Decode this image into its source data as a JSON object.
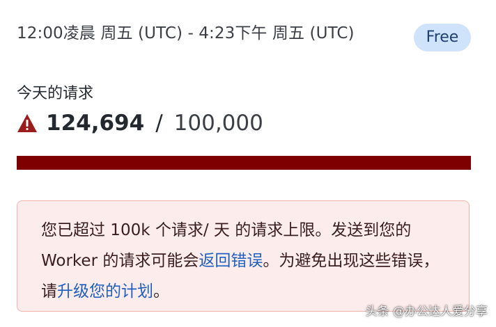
{
  "header": {
    "time_range": "12:00凌晨 周五 (UTC) - 4:23下午 周五 (UTC)",
    "plan_badge": "Free"
  },
  "requests": {
    "label": "今天的请求",
    "warning_icon": "warning-triangle-icon",
    "current": "124,694",
    "separator": "/",
    "limit": "100,000",
    "progress_fraction": 1.0
  },
  "alert": {
    "text_before": "您已超过 100k 个请求/ 天 的请求上限。发送到您的 Worker 的请求可能会",
    "link_errors": "返回错误",
    "text_middle": "。为避免出现这些错误，请",
    "link_upgrade": "升级您的计划",
    "text_end": "。"
  },
  "watermark": {
    "text": "头条 @办公达人爱分享"
  },
  "colors": {
    "progress_fill": "#7f0000",
    "alert_bg": "#fdecec",
    "alert_border": "#f0b4ad",
    "badge_bg": "#cfe3fb",
    "warning": "#9b1c1c",
    "link": "#1f5fbf"
  }
}
